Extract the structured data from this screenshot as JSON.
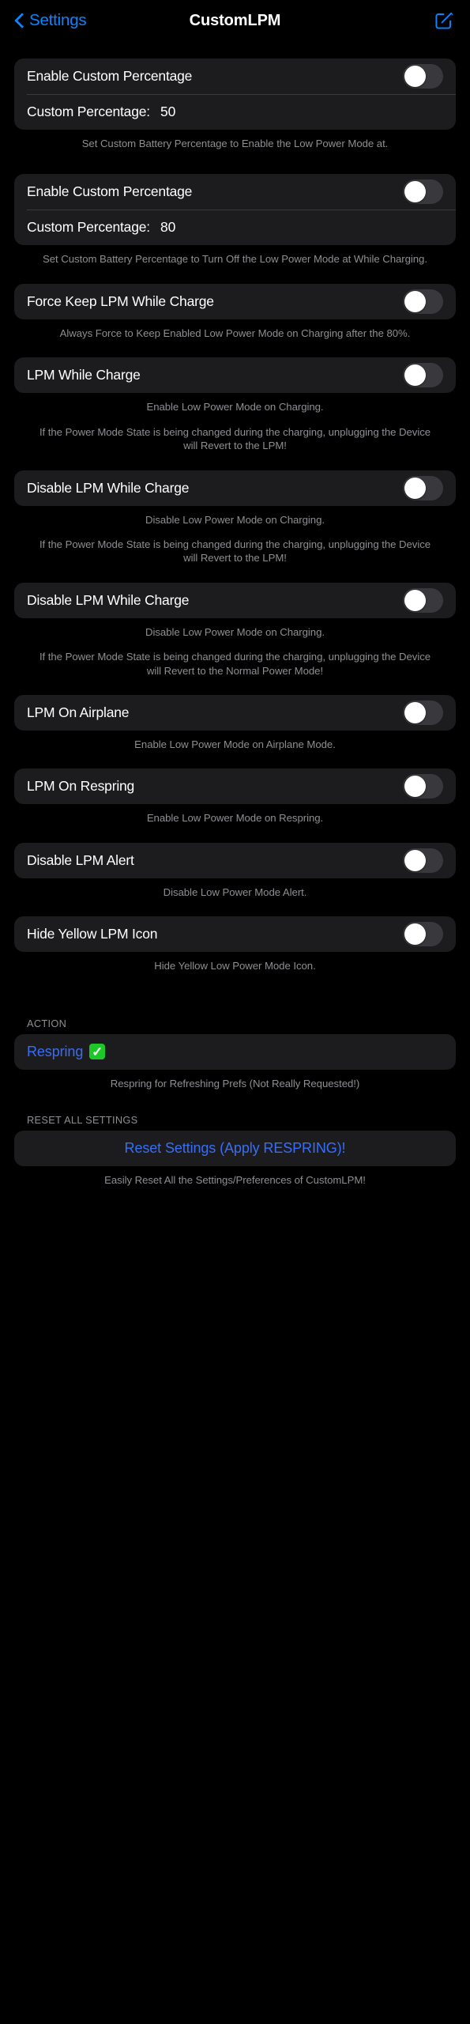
{
  "navbar": {
    "back_label": "Settings",
    "title": "CustomLPM",
    "compose_icon": "compose-icon",
    "back_icon": "chevron-left-icon"
  },
  "sections": [
    {
      "id": "custom-percentage-enable",
      "rows": [
        {
          "type": "toggle",
          "label": "Enable Custom Percentage",
          "value": "off"
        },
        {
          "type": "value",
          "label": "Custom Percentage:",
          "value": "50"
        }
      ],
      "footer": [
        "Set Custom Battery Percentage to Enable the Low Power Mode at."
      ]
    },
    {
      "id": "custom-percentage-turnoff",
      "rows": [
        {
          "type": "toggle",
          "label": "Enable Custom Percentage",
          "value": "off"
        },
        {
          "type": "value",
          "label": "Custom Percentage:",
          "value": "80"
        }
      ],
      "footer": [
        "Set Custom Battery Percentage to Turn Off the Low Power Mode at While Charging."
      ]
    },
    {
      "id": "force-keep-lpm-while-charge",
      "rows": [
        {
          "type": "toggle",
          "label": "Force Keep LPM While Charge",
          "value": "off"
        }
      ],
      "footer": [
        "Always Force to Keep Enabled Low Power Mode on Charging after the 80%."
      ]
    },
    {
      "id": "lpm-while-charge",
      "rows": [
        {
          "type": "toggle",
          "label": "LPM While Charge",
          "value": "off"
        }
      ],
      "footer": [
        "Enable Low Power Mode on Charging.",
        "If the Power Mode State is being changed during the charging, unplugging the Device will Revert to the LPM!"
      ]
    },
    {
      "id": "disable-lpm-while-charge-1",
      "rows": [
        {
          "type": "toggle",
          "label": "Disable LPM While Charge",
          "value": "off"
        }
      ],
      "footer": [
        "Disable Low Power Mode on Charging.",
        "If the Power Mode State is being changed during the charging, unplugging the Device will Revert to the LPM!"
      ]
    },
    {
      "id": "disable-lpm-while-charge-2",
      "rows": [
        {
          "type": "toggle",
          "label": "Disable LPM While Charge",
          "value": "off"
        }
      ],
      "footer": [
        "Disable Low Power Mode on Charging.",
        "If the Power Mode State is being changed during the charging, unplugging the Device will Revert to the Normal Power Mode!"
      ]
    },
    {
      "id": "lpm-on-airplane",
      "rows": [
        {
          "type": "toggle",
          "label": "LPM On Airplane",
          "value": "off"
        }
      ],
      "footer": [
        "Enable Low Power Mode on Airplane Mode."
      ]
    },
    {
      "id": "lpm-on-respring",
      "rows": [
        {
          "type": "toggle",
          "label": "LPM On Respring",
          "value": "off"
        }
      ],
      "footer": [
        "Enable Low Power Mode on Respring."
      ]
    },
    {
      "id": "disable-lpm-alert",
      "rows": [
        {
          "type": "toggle",
          "label": "Disable LPM Alert",
          "value": "off"
        }
      ],
      "footer": [
        "Disable Low Power Mode Alert."
      ]
    },
    {
      "id": "hide-yellow-lpm-icon",
      "rows": [
        {
          "type": "toggle",
          "label": "Hide Yellow LPM Icon",
          "value": "off"
        }
      ],
      "footer": [
        "Hide Yellow Low Power Mode Icon."
      ]
    }
  ],
  "action_section": {
    "header": "ACTION",
    "button_label": "Respring",
    "button_badge": "✓",
    "badge_color": "#1ec728",
    "footer": "Respring for Refreshing Prefs (Not Really Requested!)"
  },
  "reset_section": {
    "header": "RESET ALL SETTINGS",
    "button_label": "Reset Settings (Apply RESPRING)!",
    "footer": "Easily Reset All the Settings/Preferences of CustomLPM!"
  },
  "colors": {
    "accent_blue": "#0a84ff",
    "link_blue": "#386ef6",
    "group_bg": "#1c1c1e",
    "footer_text": "#8e8e93",
    "page_bg": "#000000",
    "switch_off": "#39393d"
  }
}
